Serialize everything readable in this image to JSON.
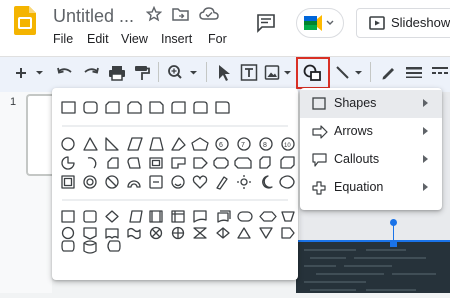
{
  "document": {
    "title": "Untitled ..."
  },
  "menu": [
    "File",
    "Edit",
    "View",
    "Insert",
    "For"
  ],
  "header": {
    "slideshow_label": "Slideshow"
  },
  "filmstrip": {
    "slide_number": "1"
  },
  "submenu": {
    "items": [
      {
        "label": "Shapes",
        "icon": "rectangle-icon",
        "selected": true
      },
      {
        "label": "Arrows",
        "icon": "arrow-icon",
        "selected": false
      },
      {
        "label": "Callouts",
        "icon": "callout-icon",
        "selected": false
      },
      {
        "label": "Equation",
        "icon": "plus-icon",
        "selected": false
      }
    ]
  },
  "colors": {
    "accent": "#1a73e8",
    "highlight_box": "#d93025",
    "docs_yellow": "#f4b400",
    "selected_row": "#e8eaed"
  }
}
